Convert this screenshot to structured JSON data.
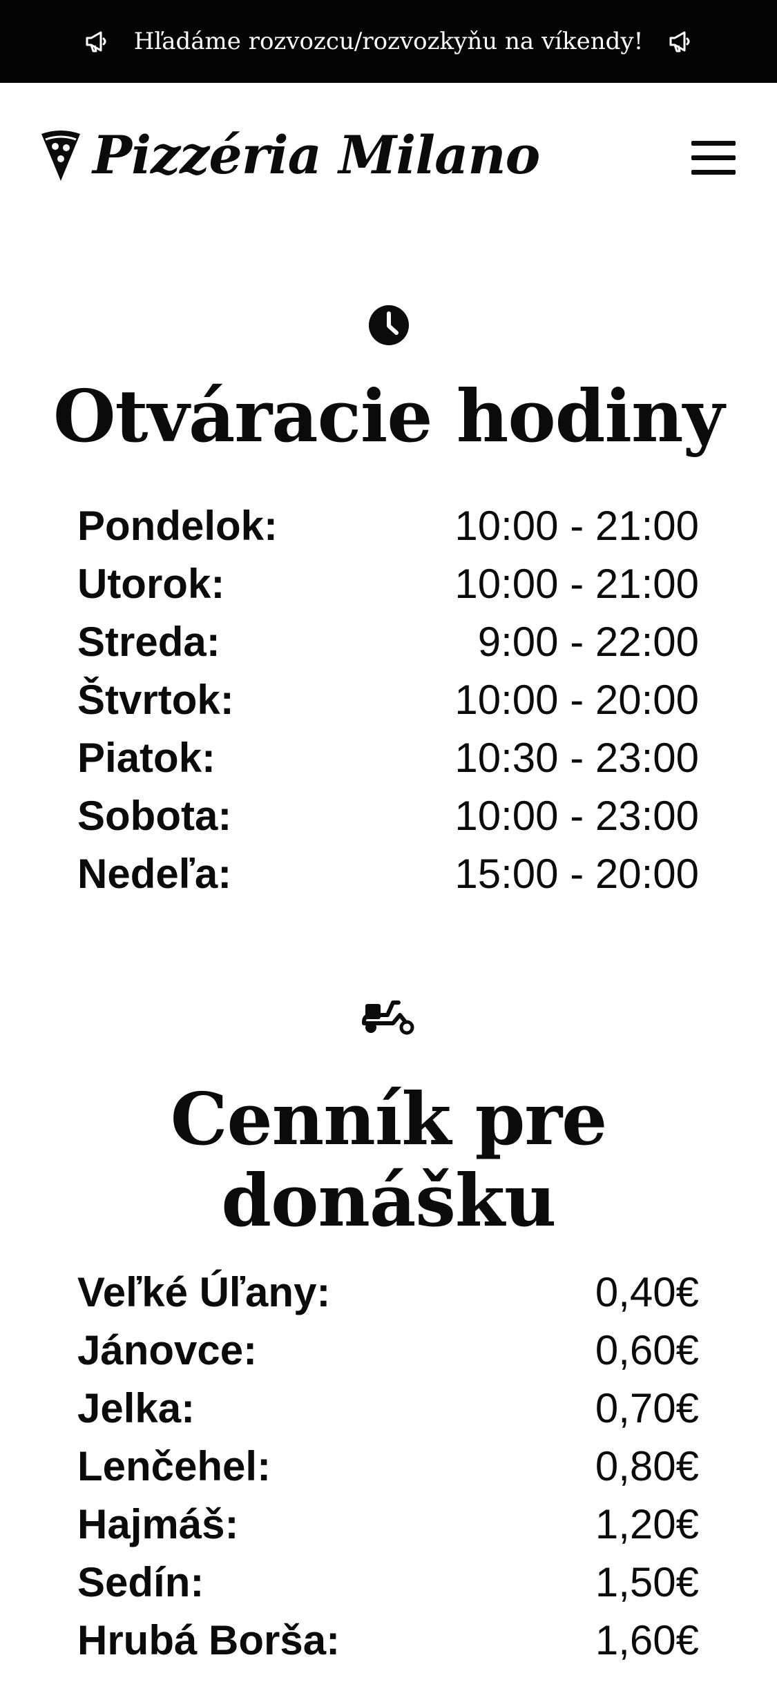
{
  "announcement": {
    "text": "Hľadáme rozvozcu/rozvozkyňu na víkendy!",
    "left_icon": "megaphone-icon",
    "right_icon": "megaphone-icon"
  },
  "header": {
    "logo_text": "Pizzéria Milano",
    "logo_icon": "pizza-slice-icon",
    "menu_icon": "hamburger-menu-icon"
  },
  "hours": {
    "icon": "clock-icon",
    "title": "Otváracie hodiny",
    "rows": [
      {
        "day": "Pondelok:",
        "time": "10:00 - 21:00"
      },
      {
        "day": "Utorok:",
        "time": "10:00 - 21:00"
      },
      {
        "day": "Streda:",
        "time": "9:00 - 22:00"
      },
      {
        "day": "Štvrtok:",
        "time": "10:00 - 20:00"
      },
      {
        "day": "Piatok:",
        "time": "10:30 - 23:00"
      },
      {
        "day": "Sobota:",
        "time": "10:00 - 23:00"
      },
      {
        "day": "Nedeľa:",
        "time": "15:00 - 20:00"
      }
    ]
  },
  "delivery": {
    "icon": "scooter-icon",
    "title": "Cenník pre donášku",
    "title_line1": "Cenník pre",
    "title_line2": "donášku",
    "rows": [
      {
        "place": "Veľké Úľany:",
        "price": "0,40€"
      },
      {
        "place": "Jánovce:",
        "price": "0,60€"
      },
      {
        "place": "Jelka:",
        "price": "0,70€"
      },
      {
        "place": "Lenčehel:",
        "price": "0,80€"
      },
      {
        "place": "Hajmáš:",
        "price": "1,20€"
      },
      {
        "place": "Sedín:",
        "price": "1,50€"
      },
      {
        "place": "Hrubá Borša:",
        "price": "1,60€"
      }
    ]
  },
  "colors": {
    "bar_background": "#050505",
    "bar_text": "#ffffff",
    "text": "#0b0b0b",
    "background": "#ffffff"
  }
}
